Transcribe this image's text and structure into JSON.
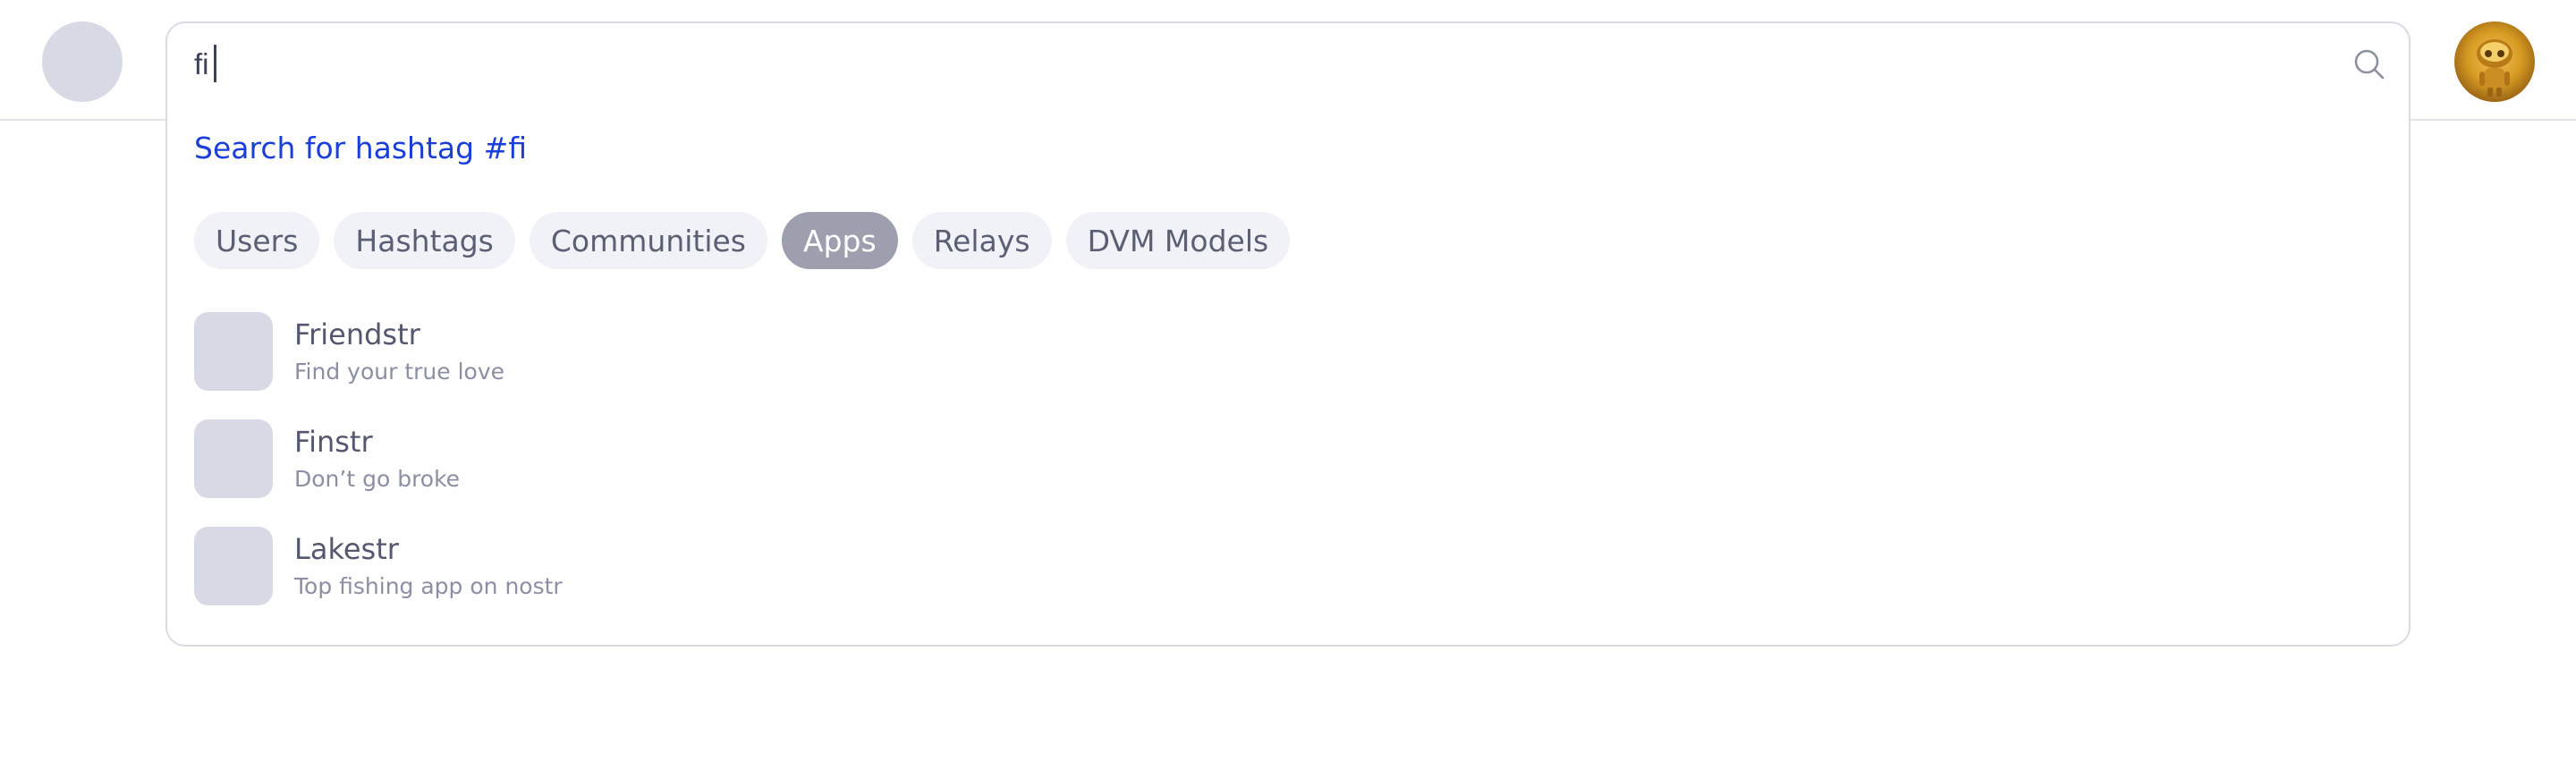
{
  "search": {
    "value": "fi",
    "hashtag_link": "Search for hashtag #fi",
    "icon": "search-icon"
  },
  "tabs": [
    {
      "label": "Users",
      "active": false
    },
    {
      "label": "Hashtags",
      "active": false
    },
    {
      "label": "Communities",
      "active": false
    },
    {
      "label": "Apps",
      "active": true
    },
    {
      "label": "Relays",
      "active": false
    },
    {
      "label": "DVM Models",
      "active": false
    }
  ],
  "results": [
    {
      "name": "Friendstr",
      "description": "Find your true love"
    },
    {
      "name": "Finstr",
      "description": "Don’t go broke"
    },
    {
      "name": "Lakestr",
      "description": "Top fishing app on nostr"
    }
  ],
  "colors": {
    "accent_link": "#1a3fd8",
    "tab_active_bg": "#9d9fae",
    "tab_bg": "#f1f2f7",
    "placeholder_gray": "#d7d9e5"
  }
}
